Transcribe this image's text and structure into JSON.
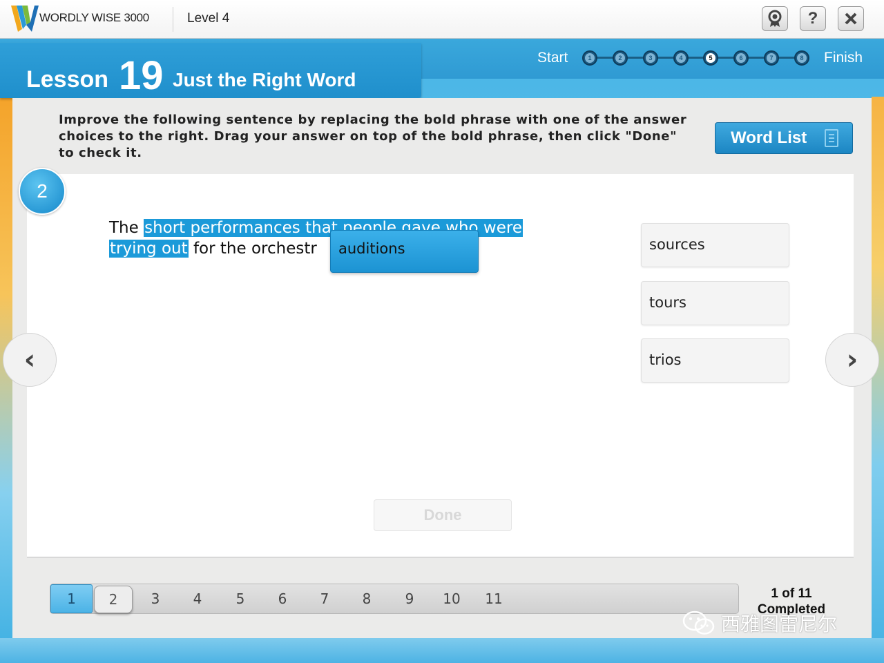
{
  "header": {
    "brand": "WORDLY WISE 3000",
    "level": "Level 4",
    "icons": [
      "badge-icon",
      "help-icon",
      "close-icon"
    ]
  },
  "lesson": {
    "word": "Lesson",
    "number": "19",
    "title": "Just the Right Word"
  },
  "progress": {
    "start_label": "Start",
    "finish_label": "Finish",
    "steps": [
      "1",
      "2",
      "3",
      "4",
      "5",
      "6",
      "7",
      "8"
    ],
    "active_step": "5"
  },
  "instructions": "Improve the following sentence by replacing the bold phrase with one of the answer choices to the right. Drag your answer on top of the bold phrase, then click \"Done\" to check it.",
  "word_list_label": "Word List",
  "question": {
    "number": "2",
    "text_before": "The ",
    "highlight_line1": "short performances that people gave who were",
    "highlight_line2": "trying out",
    "text_after": " for the orchestr",
    "dragged_choice": "auditions"
  },
  "choices": [
    "sources",
    "tours",
    "trios"
  ],
  "nav": {
    "prev_icon": "chevron-left-icon",
    "next_icon": "chevron-right-icon"
  },
  "done_label": "Done",
  "pager": {
    "pages": [
      "1",
      "2",
      "3",
      "4",
      "5",
      "6",
      "7",
      "8",
      "9",
      "10",
      "11"
    ],
    "current": "1",
    "selected": "2",
    "completed_count": "1 of 11",
    "completed_label": "Completed"
  },
  "watermark": "西雅图雷尼尔",
  "colors": {
    "accent_blue": "#1b9ad9",
    "header_blue": "#2f9ad3",
    "done_disabled": "#d8d8d8"
  }
}
